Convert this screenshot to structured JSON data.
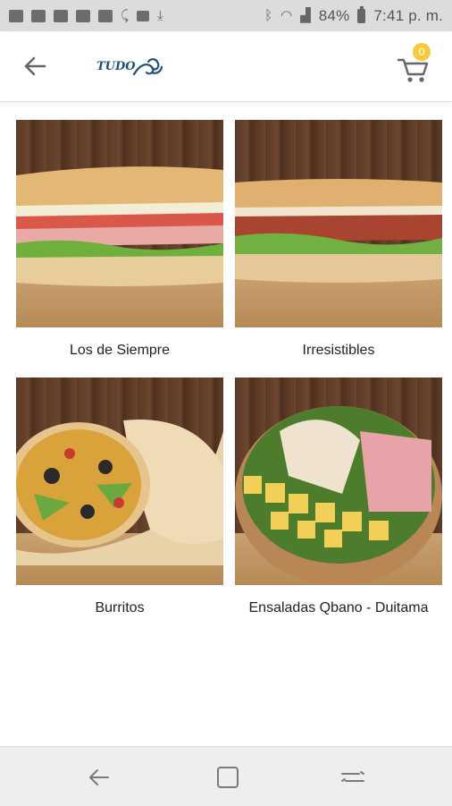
{
  "status_bar": {
    "battery": "84%",
    "time": "7:41 p. m."
  },
  "header": {
    "logo_text": "TUDO",
    "cart_count": "0"
  },
  "categories": [
    {
      "label": "Los de Siempre"
    },
    {
      "label": "Irresistibles"
    },
    {
      "label": "Burritos"
    },
    {
      "label": "Ensaladas Qbano - Duitama"
    }
  ],
  "colors": {
    "badge": "#f7c93e",
    "logo": "#1f4e79"
  }
}
